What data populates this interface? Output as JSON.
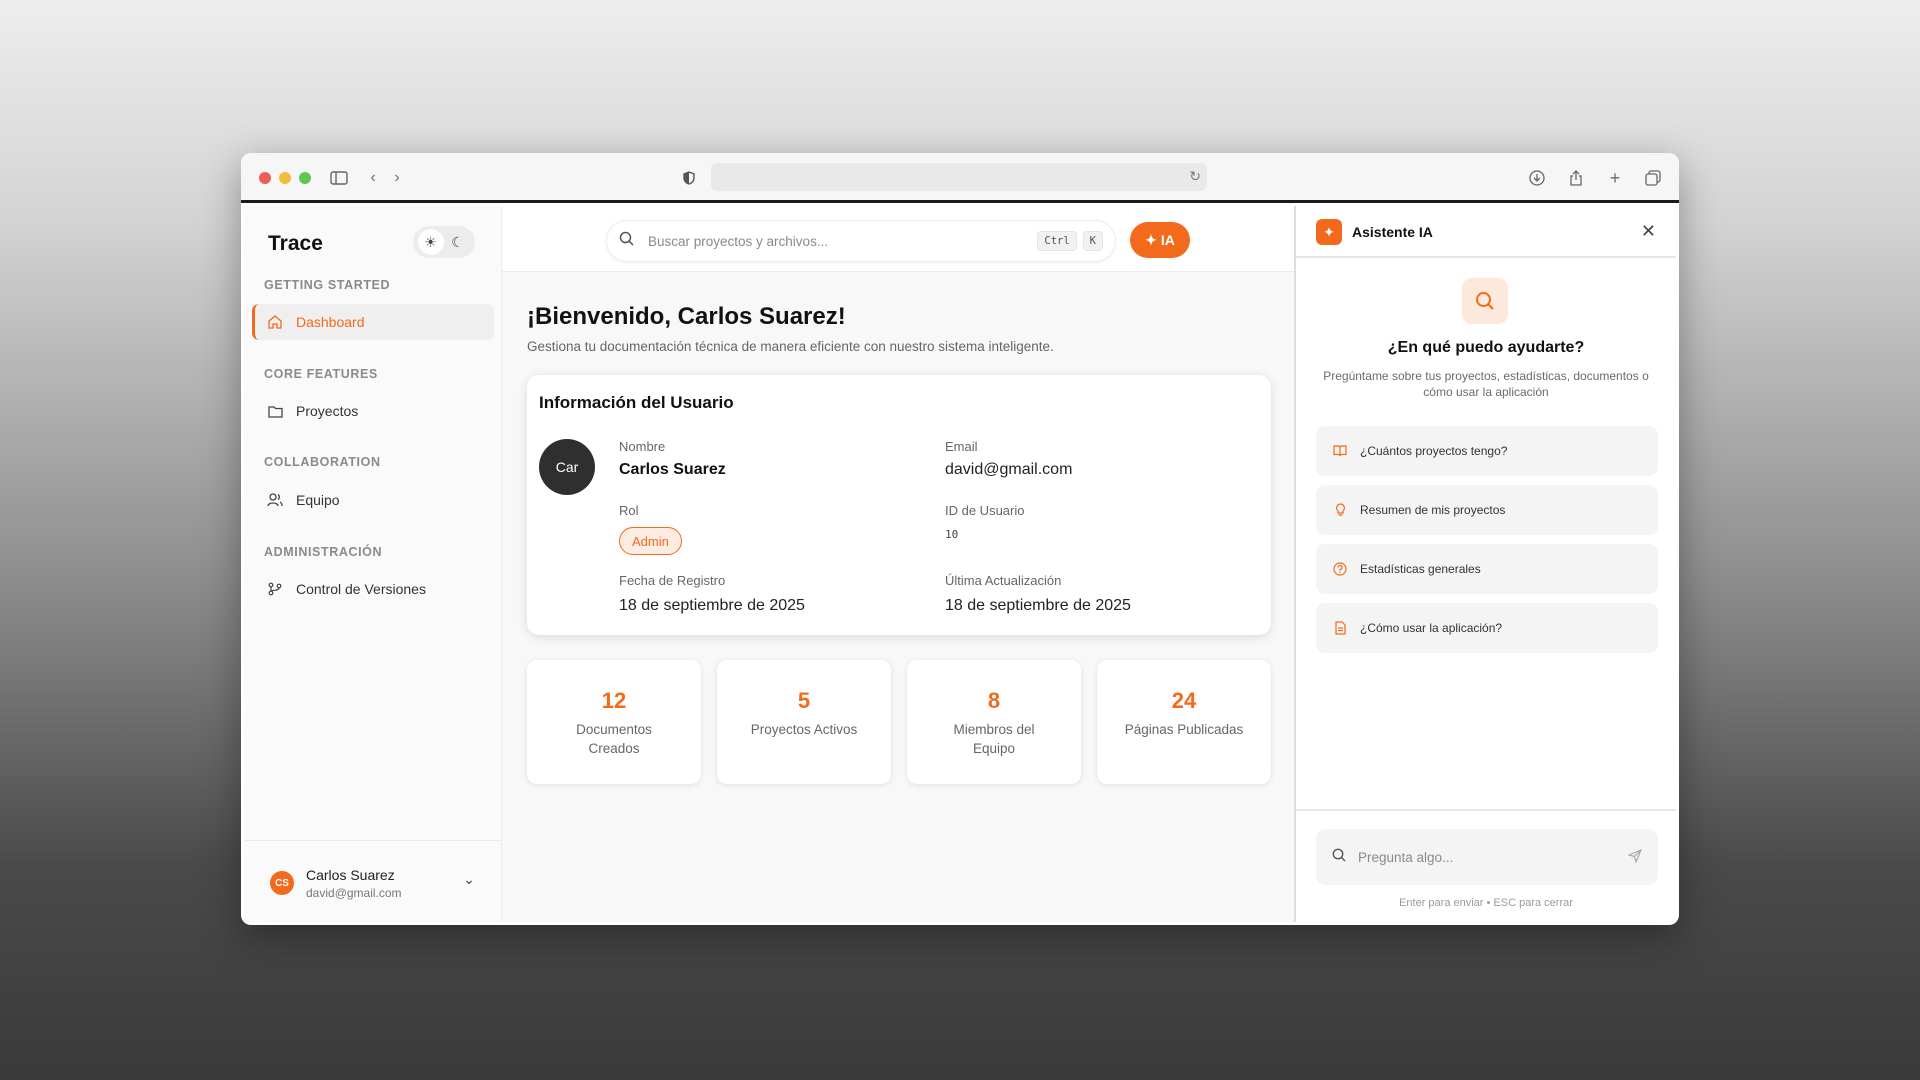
{
  "colors": {
    "accent": "#f26a1b",
    "avatar_dark": "#2f2f2f"
  },
  "sidebar": {
    "brand": "Trace",
    "sections": [
      {
        "title": "GETTING STARTED",
        "items": [
          {
            "label": "Dashboard",
            "icon": "home-icon",
            "active": true
          }
        ]
      },
      {
        "title": "CORE FEATURES",
        "items": [
          {
            "label": "Proyectos",
            "icon": "folder-icon"
          }
        ]
      },
      {
        "title": "COLLABORATION",
        "items": [
          {
            "label": "Equipo",
            "icon": "users-icon"
          }
        ]
      },
      {
        "title": "ADMINISTRACIÓN",
        "items": [
          {
            "label": "Control de Versiones",
            "icon": "git-branch-icon"
          }
        ]
      }
    ],
    "user": {
      "initials": "CS",
      "name": "Carlos Suarez",
      "email": "david@gmail.com"
    }
  },
  "topbar": {
    "search_placeholder": "Buscar proyectos y archivos...",
    "shortcut_ctrl": "Ctrl",
    "shortcut_k": "K",
    "ia_label": "IA"
  },
  "main": {
    "welcome": "¡Bienvenido, Carlos Suarez!",
    "subtitle": "Gestiona tu documentación técnica de manera eficiente con nuestro sistema inteligente.",
    "user_card": {
      "title": "Información del Usuario",
      "avatar_text": "Car",
      "name_label": "Nombre",
      "name_value": "Carlos Suarez",
      "email_label": "Email",
      "email_value": "david@gmail.com",
      "role_label": "Rol",
      "role_value": "Admin",
      "id_label": "ID de Usuario",
      "id_value": "10",
      "reg_label": "Fecha de Registro",
      "reg_value": "18 de septiembre de 2025",
      "upd_label": "Última Actualización",
      "upd_value": "18 de septiembre de 2025"
    },
    "stats": [
      {
        "value": "12",
        "label": "Documentos Creados"
      },
      {
        "value": "5",
        "label": "Proyectos Activos"
      },
      {
        "value": "8",
        "label": "Miembros del Equipo"
      },
      {
        "value": "24",
        "label": "Páginas Publicadas"
      }
    ]
  },
  "assistant": {
    "title": "Asistente IA",
    "question": "¿En qué puedo ayudarte?",
    "description": "Pregúntame sobre tus proyectos, estadísticas, documentos o cómo usar la aplicación",
    "suggestions": [
      {
        "label": "¿Cuántos proyectos tengo?",
        "icon": "book-icon"
      },
      {
        "label": "Resumen de mis proyectos",
        "icon": "lightbulb-icon"
      },
      {
        "label": "Estadísticas generales",
        "icon": "help-circle-icon"
      },
      {
        "label": "¿Cómo usar la aplicación?",
        "icon": "file-icon"
      }
    ],
    "input_placeholder": "Pregunta algo...",
    "hint": "Enter para enviar • ESC para cerrar"
  }
}
